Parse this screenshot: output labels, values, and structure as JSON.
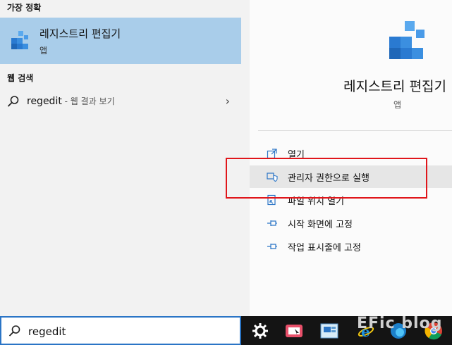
{
  "left": {
    "best_match_title": "가장 정확",
    "best_match": {
      "name": "레지스트리 편집기",
      "type": "앱"
    },
    "web_search_title": "웹 검색",
    "web_result": {
      "query": "regedit",
      "hint": " - 웹 결과 보기"
    }
  },
  "preview": {
    "name": "레지스트리 편집기",
    "type": "앱",
    "actions": [
      {
        "label": "열기",
        "icon": "open-icon"
      },
      {
        "label": "관리자 권한으로 실행",
        "icon": "shield-icon"
      },
      {
        "label": "파일 위치 열기",
        "icon": "folder-location-icon"
      },
      {
        "label": "시작 화면에 고정",
        "icon": "pin-icon"
      },
      {
        "label": "작업 표시줄에 고정",
        "icon": "pin-icon"
      }
    ]
  },
  "taskbar": {
    "search_value": "regedit",
    "watermark": "EFic blog"
  },
  "colors": {
    "selected": "#a9cdea",
    "accent": "#2b75c6",
    "highlight": "#e0161b"
  }
}
